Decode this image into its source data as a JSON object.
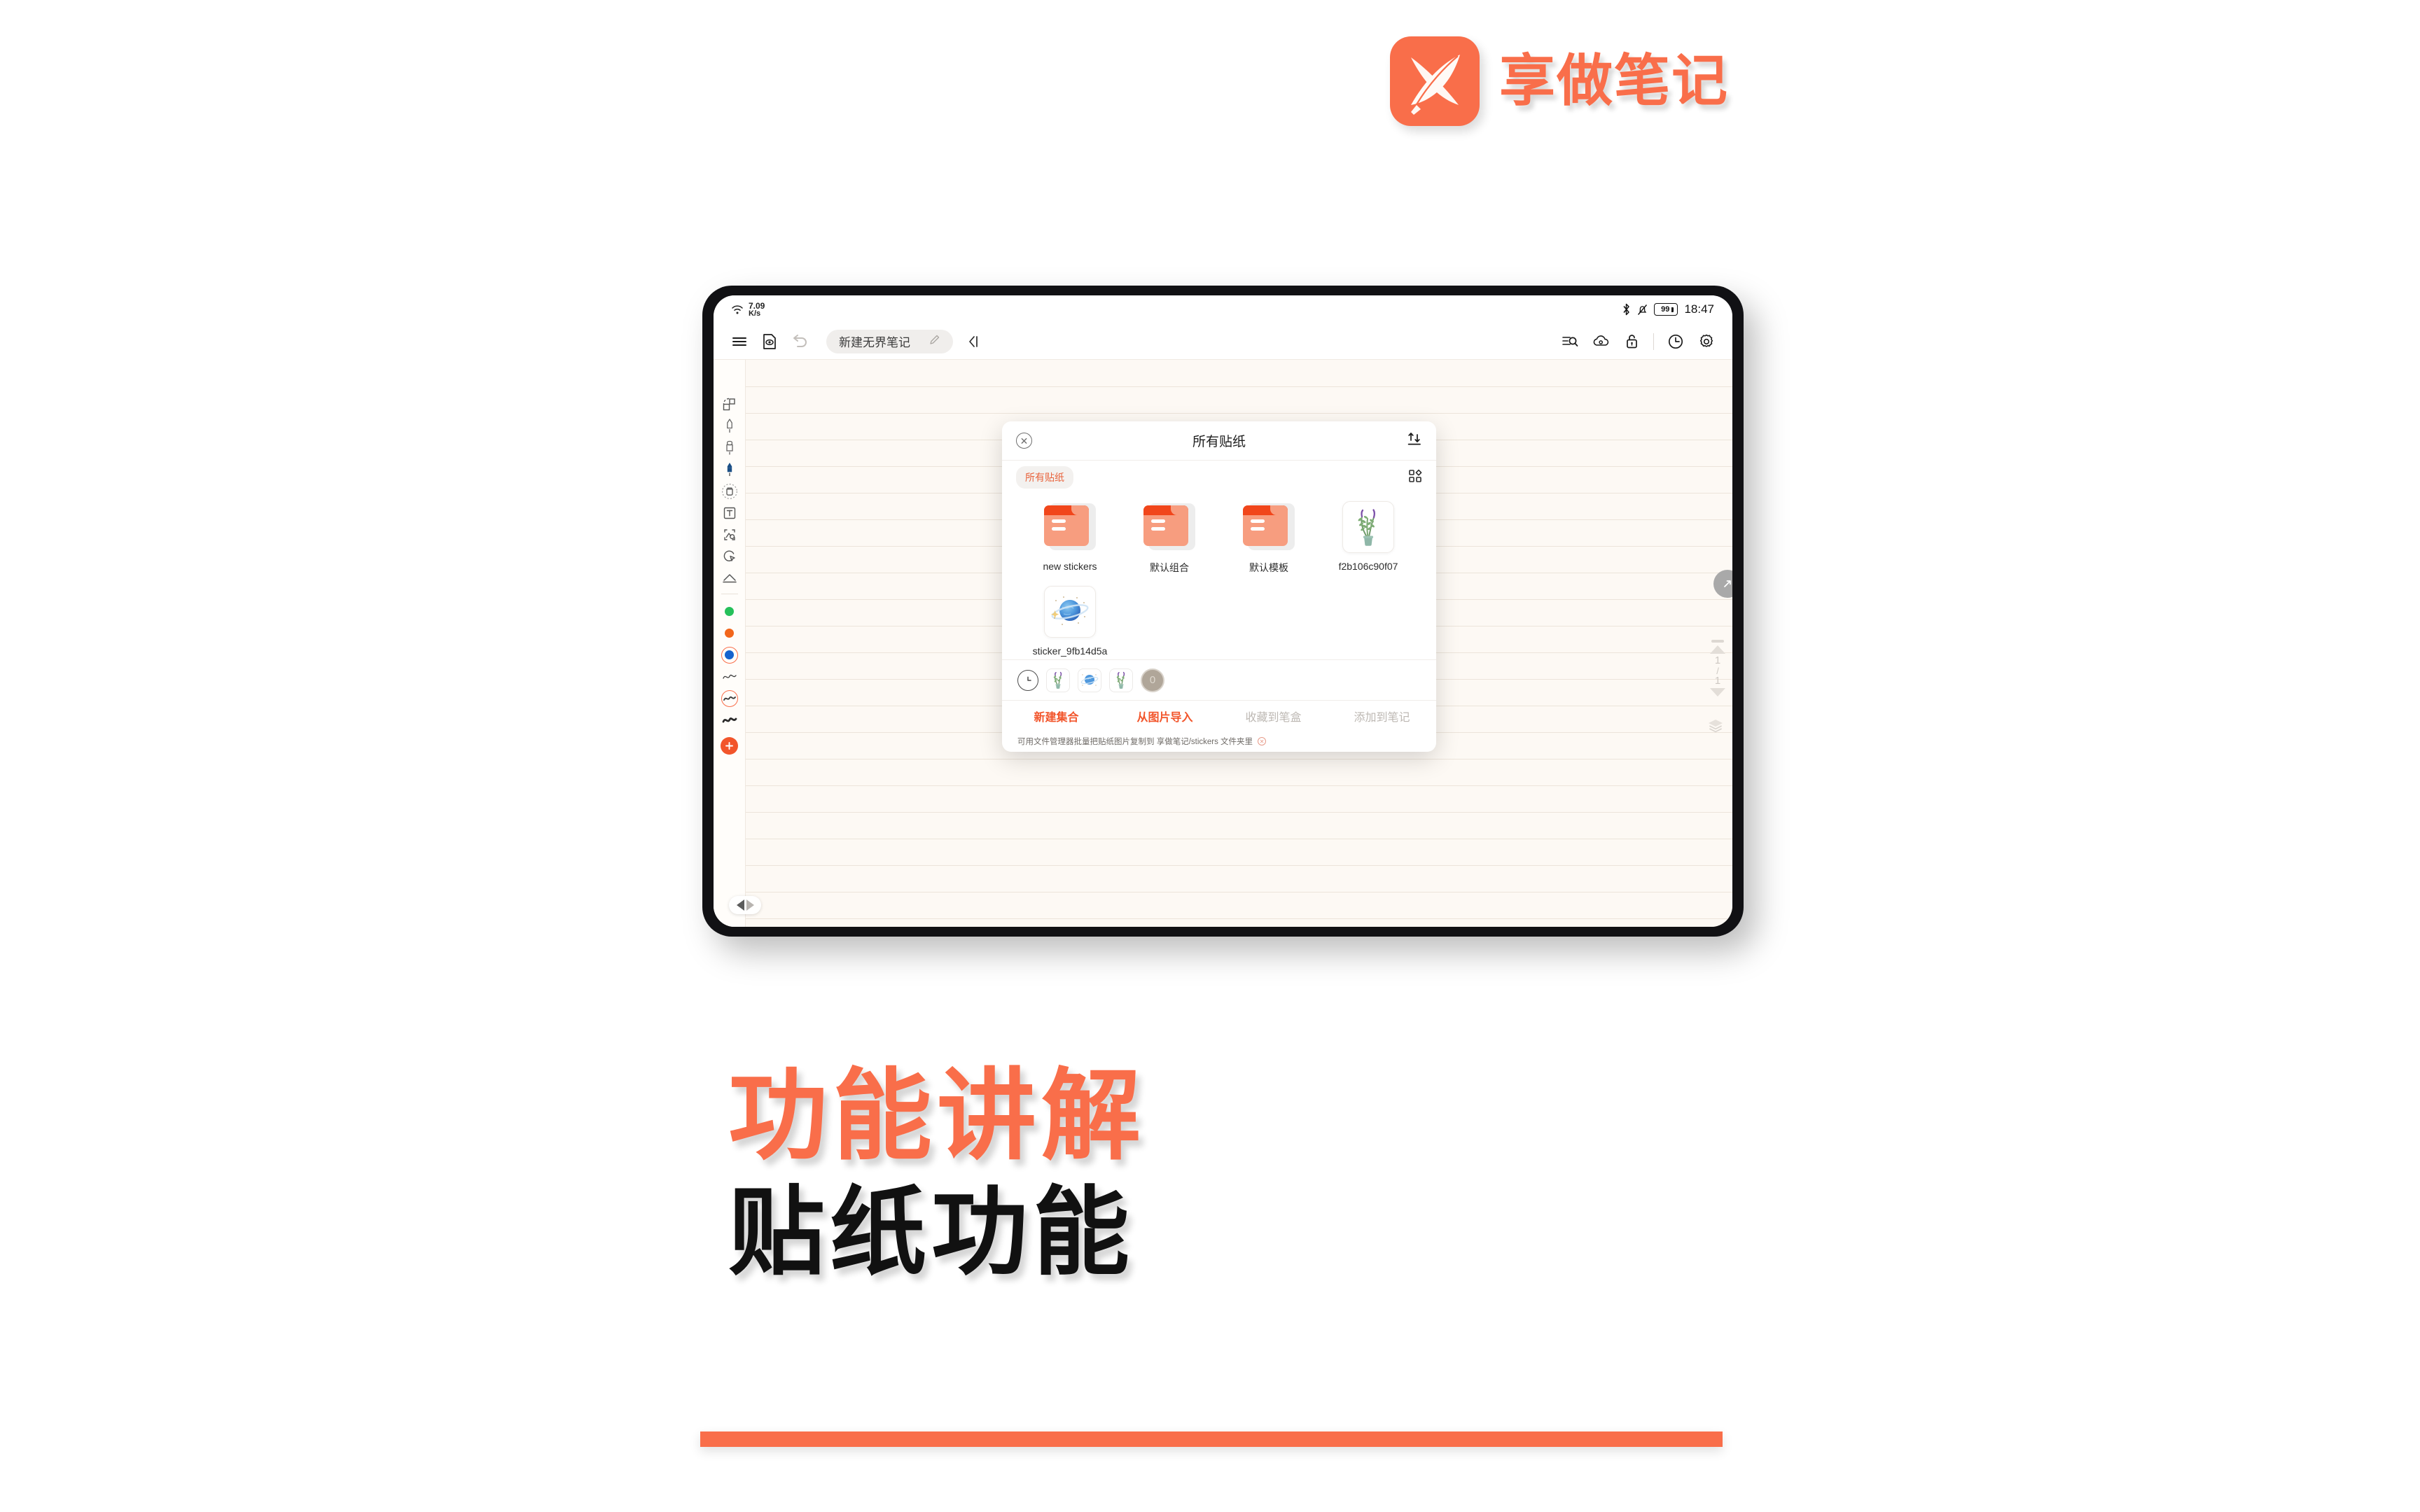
{
  "brand": {
    "name": "享做笔记",
    "logo_icon": "feather-swoosh-icon",
    "accent_color": "#F96E4A"
  },
  "device": {
    "status_bar": {
      "wifi_icon": "wifi-icon",
      "net_speed_value": "7.09",
      "net_speed_unit": "K/s",
      "bluetooth_icon": "bluetooth-icon",
      "mute_icon": "bell-muted-icon",
      "battery_level": "99",
      "time": "18:47"
    },
    "toolbar": {
      "menu_icon": "hamburger-menu-icon",
      "preview_icon": "document-eye-icon",
      "undo_icon": "undo-arrow-icon",
      "doc_title": "新建无界笔记",
      "edit_icon": "pencil-edit-icon",
      "collapse_icon": "chevron-left-bar-icon",
      "search_icon": "list-search-icon",
      "cloud_icon": "cloud-sync-icon",
      "lock_icon": "lock-icon",
      "history_icon": "clock-history-icon",
      "settings_icon": "gear-icon"
    },
    "tool_rail": {
      "tools": [
        {
          "name": "shape-select-icon",
          "label": "选择"
        },
        {
          "name": "pen-icon",
          "label": "钢笔"
        },
        {
          "name": "marker-icon",
          "label": "马克笔"
        },
        {
          "name": "fountain-pen-icon",
          "label": "书法笔"
        },
        {
          "name": "eraser-icon",
          "label": "橡皮擦"
        },
        {
          "name": "text-box-icon",
          "label": "文本"
        },
        {
          "name": "image-insert-icon",
          "label": "图片"
        },
        {
          "name": "lasso-select-icon",
          "label": "套索"
        },
        {
          "name": "shape-triangle-icon",
          "label": "形状"
        }
      ],
      "colors": [
        {
          "name": "color-green",
          "hex": "#25C05A",
          "selected": false
        },
        {
          "name": "color-orange",
          "hex": "#F2661B",
          "selected": false
        },
        {
          "name": "color-blue",
          "hex": "#1663CE",
          "selected": true
        }
      ],
      "stroke_widths": [
        {
          "name": "stroke-thin",
          "selected": false
        },
        {
          "name": "stroke-medium",
          "selected": true
        },
        {
          "name": "stroke-thick",
          "selected": false
        }
      ],
      "add_button_icon": "plus-circle-icon"
    },
    "right_controls": {
      "expand_icon": "expand-diagonal-icon",
      "page_current": "1",
      "page_total": "1",
      "page_up_icon": "triangle-up-icon",
      "page_down_icon": "triangle-down-icon",
      "layers_icon": "layers-icon"
    },
    "bottom_nav": {
      "back_icon": "triangle-left-icon",
      "forward_icon": "triangle-right-icon"
    }
  },
  "dialog": {
    "close_icon": "close-circle-icon",
    "title": "所有贴纸",
    "transfer_icon": "import-export-arrows-icon",
    "tab_chip": "所有贴纸",
    "grid_view_icon": "grid-view-icon",
    "items": [
      {
        "caption": "new stickers",
        "kind": "folder",
        "icon": "folder-icon"
      },
      {
        "caption": "默认组合",
        "kind": "folder",
        "icon": "folder-icon"
      },
      {
        "caption": "默认模板",
        "kind": "folder",
        "icon": "folder-icon"
      },
      {
        "caption": "f2b106c90f07",
        "kind": "image",
        "icon": "lavender-plant-sticker"
      },
      {
        "caption": "sticker_9fb14d5a",
        "kind": "image",
        "icon": "planet-globe-sticker"
      }
    ],
    "recent": {
      "clock_icon": "clock-recent-icon",
      "thumbs": [
        {
          "name": "lavender-plant-sticker"
        },
        {
          "name": "planet-globe-sticker"
        },
        {
          "name": "lavender-plant-sticker"
        },
        {
          "name": "placeholder-sticker"
        }
      ]
    },
    "actions": [
      {
        "label": "新建集合",
        "enabled": true
      },
      {
        "label": "从图片导入",
        "enabled": true
      },
      {
        "label": "收藏到笔盒",
        "enabled": false
      },
      {
        "label": "添加到笔记",
        "enabled": false
      }
    ],
    "hint_text": "可用文件管理器批量把贴纸图片复制到 享做笔记/stickers 文件夹里",
    "hint_close_icon": "close-small-icon"
  },
  "headline": {
    "line1": "功能讲解",
    "line2": "贴纸功能",
    "line1_color": "#F96E4A",
    "line2_color": "#111111"
  },
  "footer_bar_color": "#F96E4A"
}
